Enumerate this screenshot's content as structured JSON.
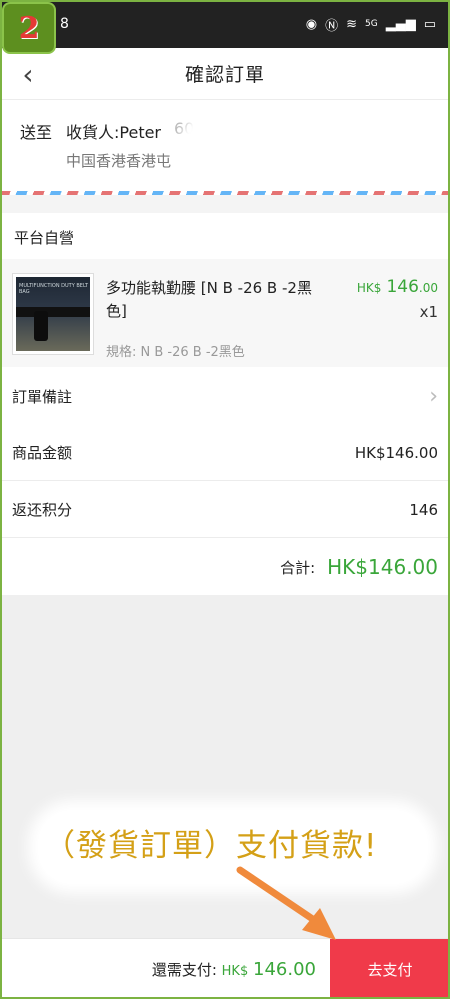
{
  "badge": "2",
  "status_bar": {
    "time": "8",
    "icons": [
      "eye-icon",
      "nfc-icon",
      "wifi-icon",
      "signal-icon",
      "battery-icon"
    ],
    "network": "5G"
  },
  "header": {
    "title": "確認訂單"
  },
  "address": {
    "label": "送至",
    "receiver": "收貨人:Peter",
    "phone_visible": "60",
    "detail": "中国香港香港屯"
  },
  "store": {
    "name": "平台自營"
  },
  "product": {
    "name": "多功能執勤腰 [N B -26 B -2黑色]",
    "spec": "規格: N B -26 B -2黑色",
    "price_currency": "HK$",
    "price_int": "146",
    "price_dec": ".00",
    "quantity": "x1",
    "thumb_label": "MULTIFUNCTION DUTY BELT BAG"
  },
  "remark": {
    "label": "訂單備註"
  },
  "goods_amount": {
    "label": "商品金额",
    "value": "HK$146.00"
  },
  "points": {
    "label": "返还积分",
    "value": "146"
  },
  "total": {
    "label": "合計:",
    "value": "HK$146.00"
  },
  "annotation": {
    "text": "（發貨訂單）支付貨款!"
  },
  "bottom": {
    "label": "還需支付:",
    "currency": "HK$",
    "amount": "146.00",
    "pay_button": "去支付"
  },
  "colors": {
    "accent_green": "#3aa63a",
    "pay_red": "#f03a4a",
    "annotation_gold": "#d4a017",
    "arrow_orange": "#f08a3c"
  }
}
